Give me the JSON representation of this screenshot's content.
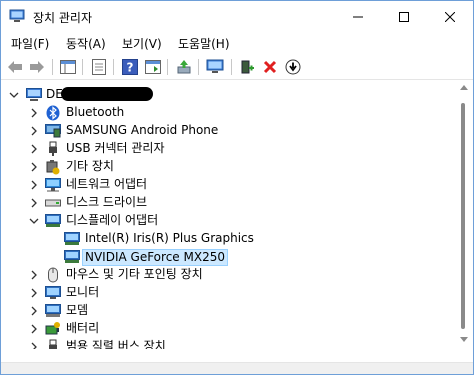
{
  "window": {
    "title": "장치 관리자"
  },
  "menu": [
    "파일(F)",
    "동작(A)",
    "보기(V)",
    "도움말(H)"
  ],
  "toolbar": {
    "buttons": [
      "back-arrow-icon",
      "forward-arrow-icon",
      "properties-icon",
      "show-hide-tree-icon",
      "help-icon",
      "action-icon",
      "update-driver-icon",
      "scan-hardware-icon",
      "add-legacy-icon",
      "uninstall-icon",
      "disable-device-icon"
    ]
  },
  "tree": {
    "root": "DE",
    "items": [
      {
        "label": "Bluetooth",
        "icon": "bluetooth-icon"
      },
      {
        "label": "SAMSUNG Android Phone",
        "icon": "monitor-icon"
      },
      {
        "label": "USB 커넥터 관리자",
        "icon": "usb-icon"
      },
      {
        "label": "기타 장치",
        "icon": "other-device-icon"
      },
      {
        "label": "네트워크 어댑터",
        "icon": "network-icon"
      },
      {
        "label": "디스크 드라이브",
        "icon": "disk-icon"
      },
      {
        "label": "디스플레이 어댑터",
        "icon": "display-adapter-icon"
      },
      {
        "label": "Intel(R) Iris(R) Plus Graphics",
        "icon": "display-adapter-icon"
      },
      {
        "label": "NVIDIA GeForce MX250",
        "icon": "display-adapter-icon"
      },
      {
        "label": "마우스 및 기타 포인팅 장치",
        "icon": "mouse-icon"
      },
      {
        "label": "모니터",
        "icon": "monitor-icon"
      },
      {
        "label": "모뎀",
        "icon": "modem-icon"
      },
      {
        "label": "배터리",
        "icon": "battery-icon"
      },
      {
        "label": "범용 직렬 버스 장치",
        "icon": "usb-device-icon"
      }
    ]
  },
  "colors": {
    "selection": "#cce8ff",
    "selection_border": "#99d1ff",
    "window_border": "#6e9fd8"
  }
}
